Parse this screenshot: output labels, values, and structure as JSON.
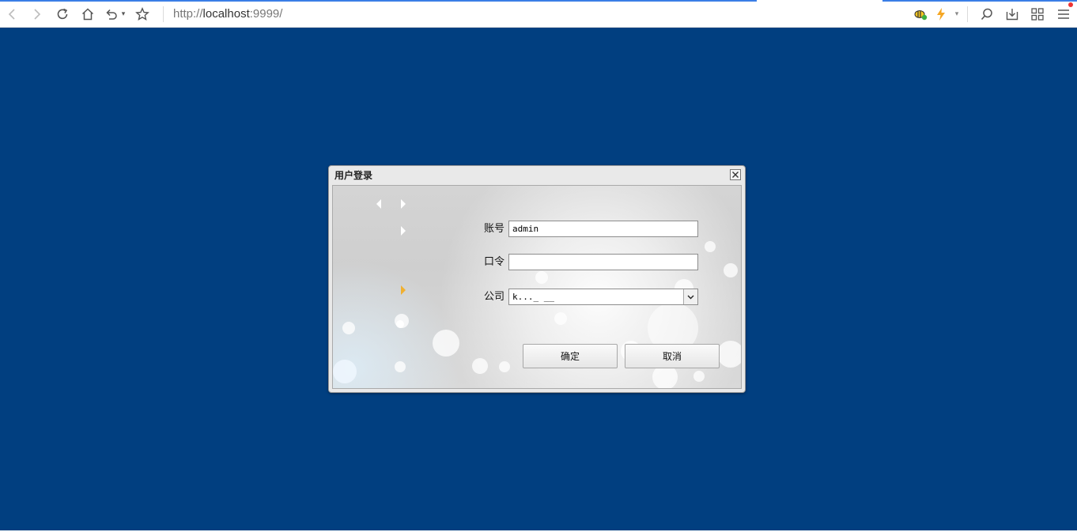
{
  "browser": {
    "url_prefix": "http://",
    "url_host": "localhost",
    "url_port": ":9999/",
    "icons": {
      "back": "back-icon",
      "forward": "forward-icon",
      "reload": "reload-icon",
      "home": "home-icon",
      "undo": "undo-icon",
      "favorite": "star-icon",
      "extension": "bee-extension-icon",
      "lightning": "lightning-icon",
      "search": "search-icon",
      "download": "download-icon",
      "apps": "apps-grid-icon",
      "menu": "menu-icon"
    }
  },
  "dialog": {
    "title": "用户登录",
    "account_label": "账号",
    "account_value": "admin",
    "password_label": "口令",
    "password_value": "",
    "company_label": "公司",
    "company_value": "k..._ __",
    "confirm_label": "确定",
    "cancel_label": "取消"
  },
  "colors": {
    "page_background": "#013f80",
    "accent": "#3b7ee6"
  }
}
